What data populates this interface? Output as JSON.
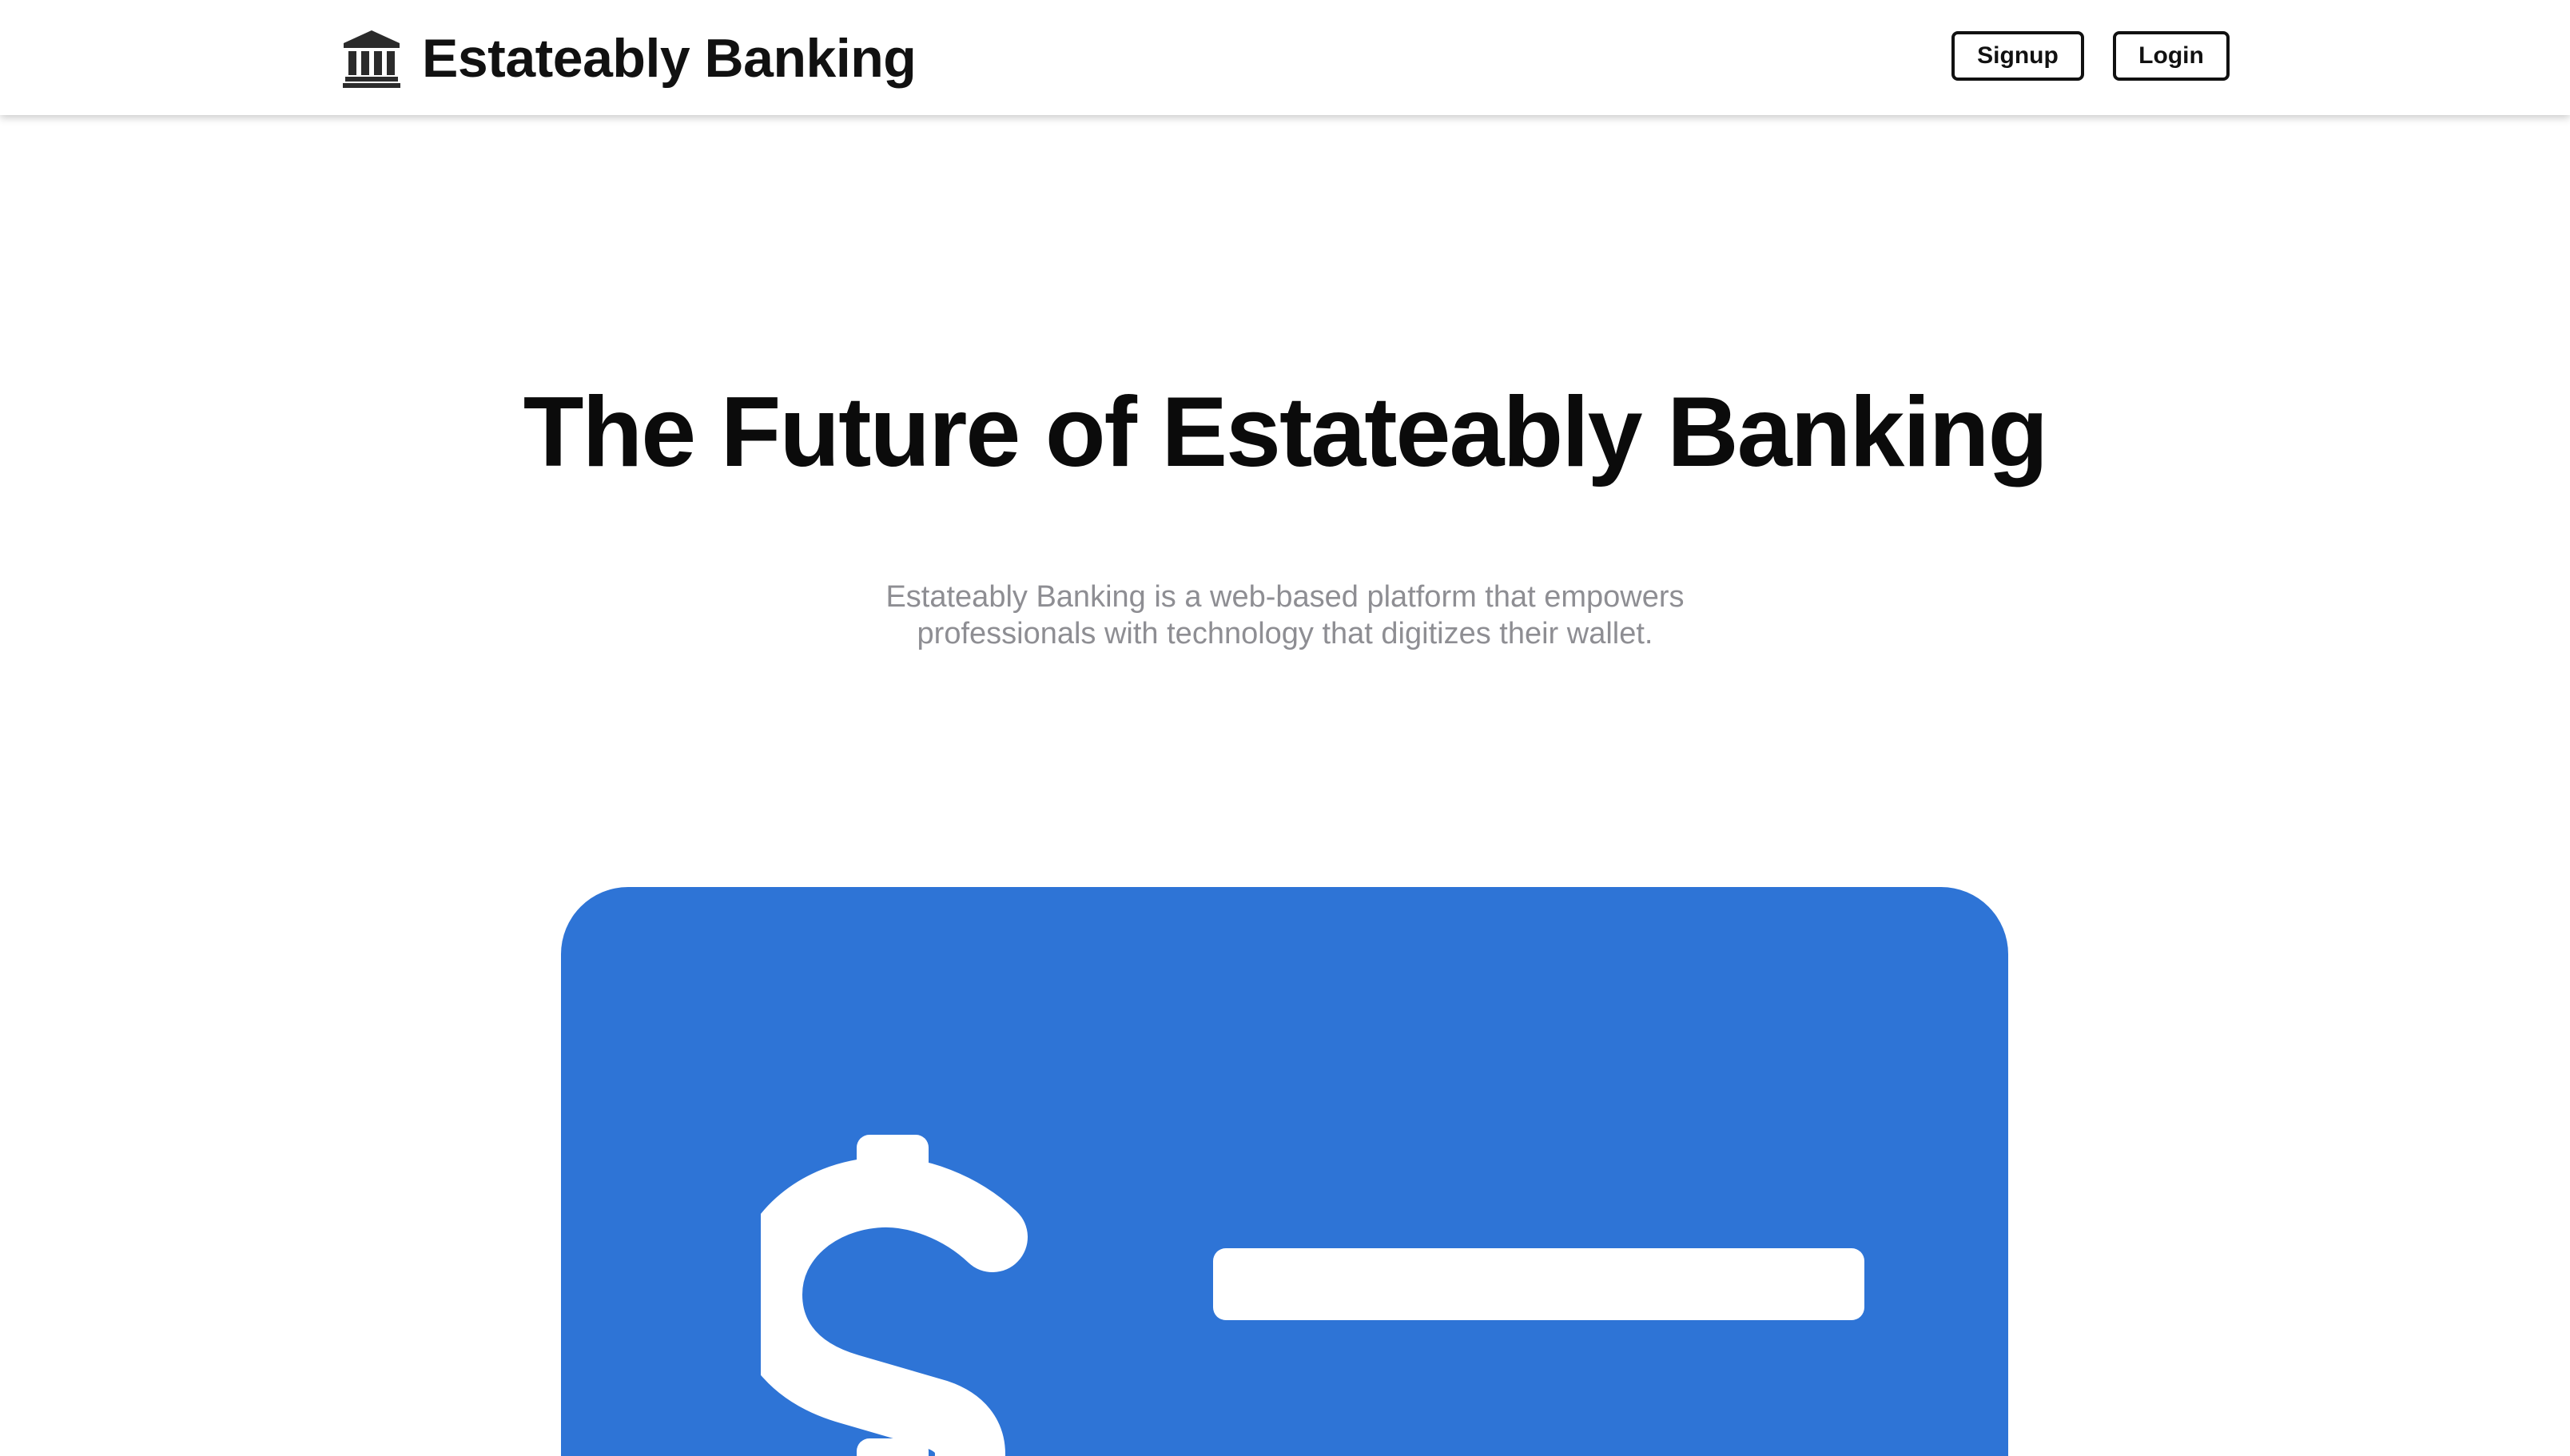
{
  "header": {
    "brand_name": "Estateably Banking",
    "brand_icon": "bank-icon",
    "signup_label": "Signup",
    "login_label": "Login"
  },
  "hero": {
    "title": "The Future of Estateably Banking",
    "subtitle": "Estateably Banking is a web-based platform that empowers professionals with technology that digitizes their wallet."
  },
  "card": {
    "icon": "dollar-icon",
    "color": "#2e74d6"
  }
}
